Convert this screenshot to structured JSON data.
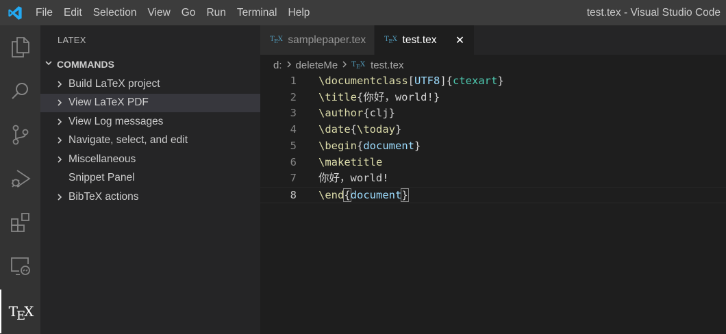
{
  "window": {
    "title": "test.tex - Visual Studio Code",
    "menu": [
      "File",
      "Edit",
      "Selection",
      "View",
      "Go",
      "Run",
      "Terminal",
      "Help"
    ]
  },
  "activity_bar": {
    "items": [
      "explorer-icon",
      "search-icon",
      "source-control-icon",
      "run-debug-icon",
      "extensions-icon",
      "remote-explorer-icon",
      "tex-icon"
    ],
    "tex_label": "TeX"
  },
  "sidebar": {
    "title": "LATEX",
    "section": "COMMANDS",
    "items": [
      {
        "label": "Build LaTeX project",
        "expandable": true
      },
      {
        "label": "View LaTeX PDF",
        "expandable": true,
        "selected": true
      },
      {
        "label": "View Log messages",
        "expandable": true
      },
      {
        "label": "Navigate, select, and edit",
        "expandable": true
      },
      {
        "label": "Miscellaneous",
        "expandable": true
      },
      {
        "label": "Snippet Panel",
        "expandable": false
      },
      {
        "label": "BibTeX actions",
        "expandable": true
      }
    ]
  },
  "tabs": [
    {
      "label": "samplepaper.tex",
      "active": false
    },
    {
      "label": "test.tex",
      "active": true,
      "close": "✕"
    }
  ],
  "breadcrumb": {
    "drive": "d:",
    "folder": "deleteMe",
    "file": "test.tex"
  },
  "editor": {
    "current_line": 8,
    "lines": [
      {
        "n": "1",
        "cmd": "\\documentclass",
        "opt": "UTF8",
        "arg": "ctexart"
      },
      {
        "n": "2",
        "cmd": "\\title",
        "text": "你好，world!"
      },
      {
        "n": "3",
        "cmd": "\\author",
        "text": "clj"
      },
      {
        "n": "4",
        "cmd": "\\date",
        "text": "\\today"
      },
      {
        "n": "5",
        "cmd": "\\begin",
        "env": "document"
      },
      {
        "n": "6",
        "cmd": "\\maketitle"
      },
      {
        "n": "7",
        "plain": "你好，world!"
      },
      {
        "n": "8",
        "cmd": "\\end",
        "env": "document"
      }
    ]
  },
  "colors": {
    "titlebar": "#3c3c3c",
    "activity_bar": "#333333",
    "sidebar": "#252526",
    "editor": "#1e1e1e",
    "keyword": "#dcdcaa",
    "argument": "#4ec9b0",
    "env": "#9cdcfe",
    "tex_icon": "#519aba",
    "vscode_blue": "#23a9f2"
  }
}
